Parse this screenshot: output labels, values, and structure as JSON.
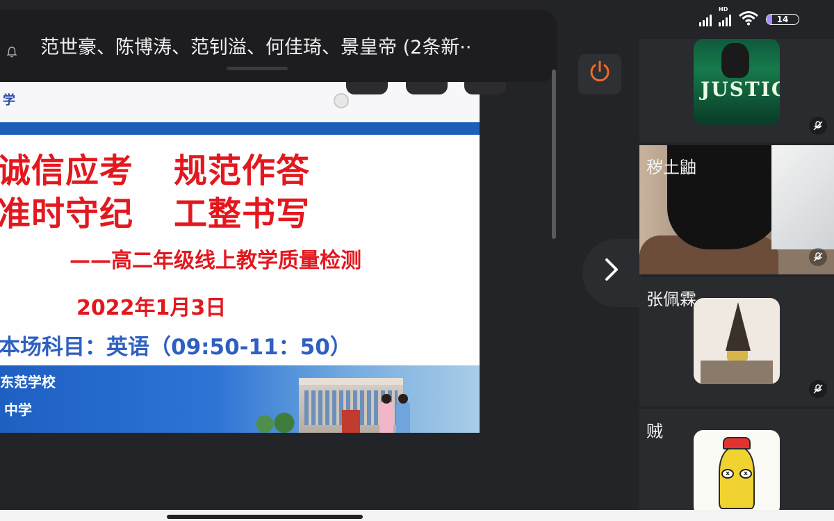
{
  "status_bar": {
    "network_label": "HD",
    "wifi_icon": "wifi-icon",
    "battery_level": "14",
    "battery_color": "#a58bff"
  },
  "notification": {
    "text": "范世豪、陈博涛、范钊溢、何佳琦、景皇帝 (2条新··",
    "icon": "bell-off-icon"
  },
  "slide": {
    "header_char": "学",
    "line1_left": "诚信应考",
    "line1_right": "规范作答",
    "line2_left": "准时守纪",
    "line2_right": "工整书写",
    "subtitle": "——高二年级线上教学质量检测",
    "date": "2022年1月3日",
    "subject": "本场科目：英语（09:50-11：50）",
    "footer_school_1": "东范学校",
    "footer_school_2": "中学",
    "accent_red": "#e3181f",
    "accent_blue": "#2f5fc0"
  },
  "controls": {
    "power_icon": "power-icon",
    "power_color": "#f16a2a",
    "next_icon": "chevron-right-icon",
    "next_glyph": "›"
  },
  "participants": [
    {
      "name": "",
      "avatar": "album-cover-avatar",
      "muted": true
    },
    {
      "name": "秽土鼬",
      "avatar": "camera-video",
      "muted": true
    },
    {
      "name": "张佩霖",
      "avatar": "cartoon-avatar",
      "muted": true
    },
    {
      "name": "贼",
      "avatar": "yellow-bird-avatar",
      "muted": false
    }
  ],
  "mic_muted_glyph": "🎙"
}
